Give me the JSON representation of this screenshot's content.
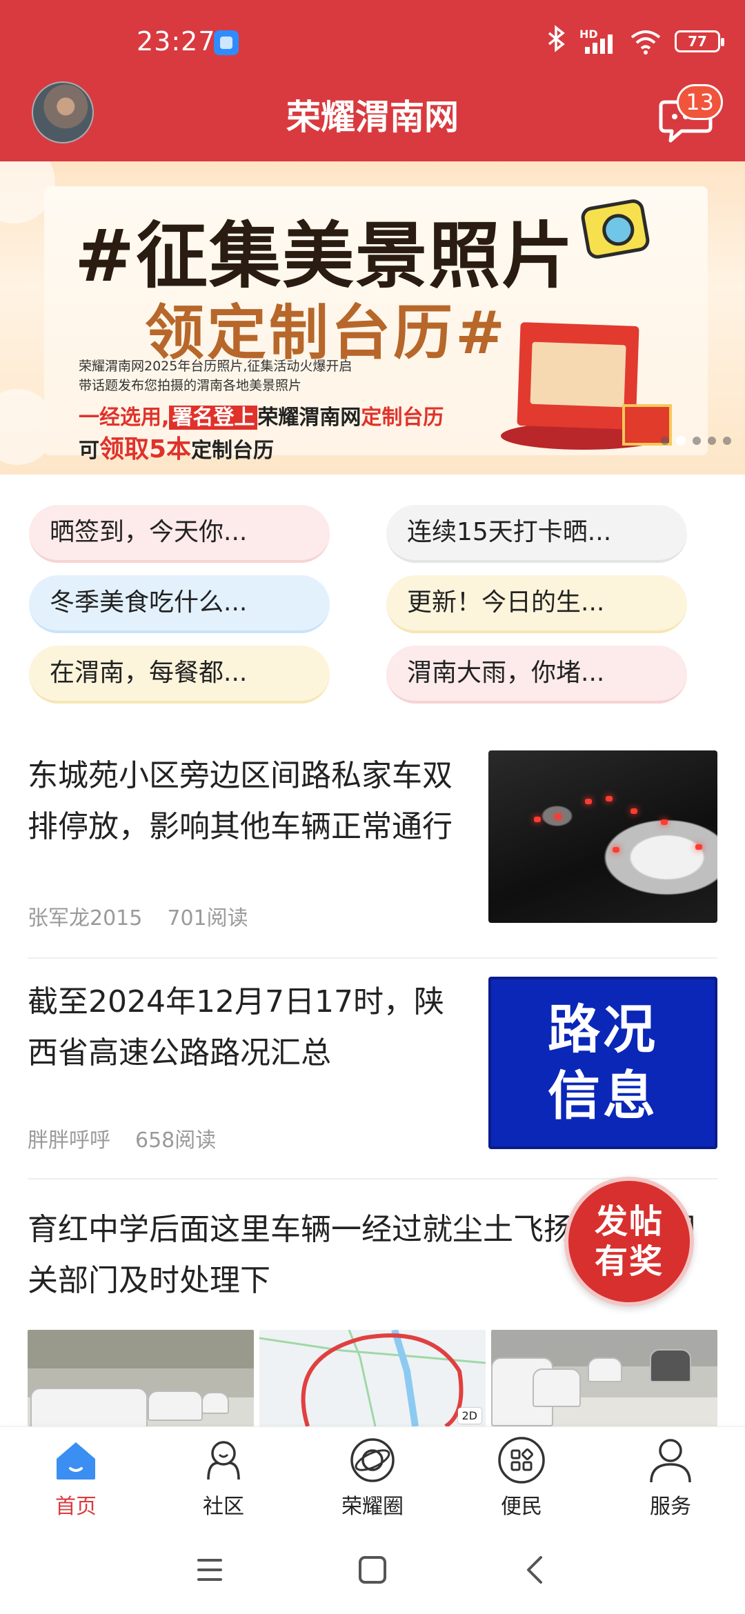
{
  "status_bar": {
    "time": "23:27",
    "network": "HD",
    "battery": "77",
    "icons": [
      "app-notification-icon",
      "bluetooth-icon",
      "signal-icon",
      "wifi-icon",
      "battery-icon"
    ]
  },
  "header": {
    "title": "荣耀渭南网",
    "message_badge": "13",
    "icons": [
      "avatar",
      "chat-icon"
    ]
  },
  "banner": {
    "headline": "#征集美景照片",
    "subheadline": "领定制台历#",
    "line1": "荣耀渭南网2025年台历照片,征集活动火爆开启",
    "line2": "带话题发布您拍摄的渭南各地美景照片",
    "line3_a": "一经选用,",
    "line3_b": "署名登上",
    "line3_c": "荣耀渭南网",
    "line3_d": "定制台历",
    "line4_a": "可",
    "line4_b": "领取5本",
    "line4_c": "定制台历",
    "slide_count": 5,
    "active_slide": 2
  },
  "topics": [
    {
      "label": "晒签到，今天你...",
      "color": "pink"
    },
    {
      "label": "连续15天打卡晒...",
      "color": "gray"
    },
    {
      "label": "冬季美食吃什么...",
      "color": "blue"
    },
    {
      "label": "更新！今日的生...",
      "color": "yellow"
    },
    {
      "label": "在渭南，每餐都...",
      "color": "yellow"
    },
    {
      "label": "渭南大雨，你堵...",
      "color": "pink"
    }
  ],
  "feed": [
    {
      "title": "东城苑小区旁边区间路私家车双排停放，影响其他车辆正常通行",
      "author": "张军龙2015",
      "reads": "701阅读"
    },
    {
      "title": "截至2024年12月7日17时，陕西省高速公路路况汇总",
      "author": "胖胖呼呼",
      "reads": "658阅读",
      "thumb_line1": "路况",
      "thumb_line2": "信息"
    },
    {
      "title": "育红中学后面这里车辆一经过就尘土飞扬，希望相关部门及时处理下",
      "map_tag": "2D"
    }
  ],
  "promo": {
    "line1": "发帖",
    "line2": "有奖"
  },
  "tabbar": [
    {
      "label": "首页",
      "icon": "home-icon",
      "active": true
    },
    {
      "label": "社区",
      "icon": "community-icon",
      "active": false
    },
    {
      "label": "荣耀圈",
      "icon": "planet-icon",
      "active": false
    },
    {
      "label": "便民",
      "icon": "grid-icon",
      "active": false
    },
    {
      "label": "服务",
      "icon": "person-icon",
      "active": false
    }
  ],
  "navbar": {
    "icons": [
      "menu-icon",
      "home-square-icon",
      "back-icon"
    ]
  },
  "colors": {
    "brand_red": "#d93a3f",
    "badge": "#f0553c",
    "promo": "#d8302f",
    "meta_gray": "#9a9a9a",
    "blue_card": "#0b27b8"
  }
}
